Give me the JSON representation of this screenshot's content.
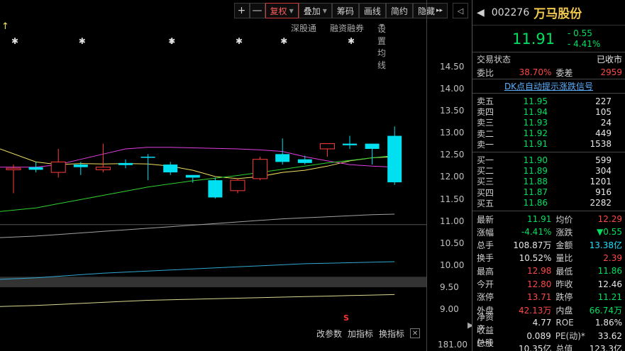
{
  "toolbar": {
    "zoom_in": "+",
    "zoom_out": "—",
    "fuquan": "复权",
    "diejia": "叠加",
    "chouma": "筹码",
    "huaxian": "画线",
    "jianyue": "简约",
    "yincang": "隐藏",
    "more": "▸▸",
    "collapse": "◁"
  },
  "subnav": {
    "shengutong": "深股通",
    "rongzi": "融资融券",
    "settings": "设置均线"
  },
  "price_axis": [
    "14.50",
    "14.00",
    "13.50",
    "13.00",
    "12.50",
    "12.00",
    "11.50",
    "11.00",
    "10.50",
    "10.00",
    "9.50",
    "9.00"
  ],
  "bottom_price": "181.00",
  "bottom_tabs": {
    "params": "改参数",
    "add": "加指标",
    "switch": "换指标",
    "close": "✕"
  },
  "marker_s": "S",
  "chart_data": {
    "type": "candlestick",
    "candles": [
      {
        "o": 12.15,
        "h": 12.25,
        "l": 11.7,
        "c": 12.18,
        "up": true
      },
      {
        "o": 12.2,
        "h": 12.3,
        "l": 12.1,
        "c": 12.15,
        "up": false
      },
      {
        "o": 12.1,
        "h": 12.55,
        "l": 12.0,
        "c": 12.3,
        "up": true
      },
      {
        "o": 12.25,
        "h": 12.3,
        "l": 12.05,
        "c": 12.2,
        "up": false
      },
      {
        "o": 12.15,
        "h": 12.65,
        "l": 12.1,
        "c": 12.2,
        "up": true
      },
      {
        "o": 12.28,
        "h": 12.35,
        "l": 12.18,
        "c": 12.24,
        "up": false
      },
      {
        "o": 12.4,
        "h": 12.45,
        "l": 11.95,
        "c": 12.38,
        "up": false
      },
      {
        "o": 12.25,
        "h": 12.3,
        "l": 12.05,
        "c": 12.1,
        "up": false
      },
      {
        "o": 12.05,
        "h": 12.05,
        "l": 11.9,
        "c": 12.0,
        "up": false
      },
      {
        "o": 11.95,
        "h": 12.0,
        "l": 11.6,
        "c": 11.62,
        "up": false
      },
      {
        "o": 11.75,
        "h": 11.98,
        "l": 11.7,
        "c": 11.95,
        "up": true
      },
      {
        "o": 11.98,
        "h": 12.4,
        "l": 11.95,
        "c": 12.35,
        "up": true
      },
      {
        "o": 12.45,
        "h": 12.75,
        "l": 12.25,
        "c": 12.3,
        "up": false
      },
      {
        "o": 12.35,
        "h": 12.42,
        "l": 12.25,
        "c": 12.28,
        "up": false
      },
      {
        "o": 12.55,
        "h": 12.65,
        "l": 12.4,
        "c": 12.65,
        "up": true
      },
      {
        "o": 12.65,
        "h": 12.8,
        "l": 12.55,
        "c": 12.62,
        "up": false
      },
      {
        "o": 12.65,
        "h": 12.65,
        "l": 12.25,
        "c": 12.55,
        "up": false
      },
      {
        "o": 12.8,
        "h": 12.98,
        "l": 11.86,
        "c": 11.91,
        "up": false
      }
    ],
    "ma_lines": [
      {
        "color": "#f0e060",
        "values": [
          12.55,
          12.3,
          12.25,
          12.27,
          12.26,
          12.27,
          12.26,
          12.22,
          12.14,
          12.02,
          11.98,
          12.02,
          12.1,
          12.14,
          12.22,
          12.32,
          12.38,
          12.4
        ]
      },
      {
        "color": "#e040e0",
        "values": [
          12.2,
          12.2,
          12.25,
          12.35,
          12.45,
          12.55,
          12.58,
          12.58,
          12.57,
          12.56,
          12.55,
          12.53,
          12.5,
          12.4,
          12.32,
          12.25,
          12.22,
          12.2
        ]
      },
      {
        "color": "#30d030",
        "values": [
          11.35,
          11.42,
          11.5,
          11.58,
          11.66,
          11.74,
          11.82,
          11.88,
          11.94,
          11.99,
          12.04,
          12.1,
          12.16,
          12.22,
          12.28,
          12.33,
          12.38,
          12.42
        ]
      },
      {
        "color": "#a0a0a0",
        "values": [
          10.85,
          10.88,
          10.91,
          10.94,
          10.97,
          11.0,
          11.03,
          11.06,
          11.09,
          11.12,
          11.15,
          11.18,
          11.21,
          11.23,
          11.25,
          11.27,
          11.29,
          11.3
        ]
      },
      {
        "color": "#30a8d0",
        "values": [
          10.05,
          10.08,
          10.11,
          10.14,
          10.17,
          10.19,
          10.21,
          10.23,
          10.25,
          10.27,
          10.29,
          10.31,
          10.33,
          10.35,
          10.36,
          10.37,
          10.38,
          10.39
        ]
      },
      {
        "color": "#d8d890",
        "values": [
          9.53,
          9.55,
          9.57,
          9.59,
          9.61,
          9.63,
          9.65,
          9.66,
          9.67,
          9.68,
          9.69,
          9.7,
          9.71,
          9.72,
          9.73,
          9.74,
          9.75,
          9.76
        ]
      }
    ],
    "ylim": [
      8.95,
      14.75
    ],
    "ref_price": 10.0,
    "star_markers": [
      0,
      3,
      7,
      10,
      12,
      15
    ],
    "arrow_marker_index": 7
  },
  "stock": {
    "back": "◀",
    "code": "002276",
    "name": "万马股份",
    "price": "11.91",
    "change": "- 0.55",
    "change_pct": "- 4.41%"
  },
  "status": {
    "label": "交易状态",
    "value": "已收市",
    "weibi_label": "委比",
    "weibi": "38.70%",
    "weicha_label": "委差",
    "weicha": "2959"
  },
  "signal_link": "DK点自动提示涨跌信号",
  "sells": [
    {
      "label": "卖五",
      "price": "11.95",
      "vol": "227"
    },
    {
      "label": "卖四",
      "price": "11.94",
      "vol": "105"
    },
    {
      "label": "卖三",
      "price": "11.93",
      "vol": "24"
    },
    {
      "label": "卖二",
      "price": "11.92",
      "vol": "449"
    },
    {
      "label": "卖一",
      "price": "11.91",
      "vol": "1538"
    }
  ],
  "buys": [
    {
      "label": "买一",
      "price": "11.90",
      "vol": "599"
    },
    {
      "label": "买二",
      "price": "11.89",
      "vol": "304"
    },
    {
      "label": "买三",
      "price": "11.88",
      "vol": "1201"
    },
    {
      "label": "买四",
      "price": "11.87",
      "vol": "916"
    },
    {
      "label": "买五",
      "price": "11.86",
      "vol": "2282"
    }
  ],
  "stats": [
    {
      "k1": "最新",
      "v1": "11.91",
      "c1": "green",
      "k2": "均价",
      "v2": "12.29",
      "c2": "red"
    },
    {
      "k1": "涨幅",
      "v1": "-4.41%",
      "c1": "green",
      "k2": "涨跌",
      "v2": "▼0.55",
      "c2": "green"
    },
    {
      "k1": "总手",
      "v1": "108.87万",
      "c1": "white",
      "k2": "金额",
      "v2": "13.38亿",
      "c2": "cyan"
    },
    {
      "k1": "换手",
      "v1": "10.52%",
      "c1": "white",
      "k2": "量比",
      "v2": "2.39",
      "c2": "red"
    },
    {
      "k1": "最高",
      "v1": "12.98",
      "c1": "red",
      "k2": "最低",
      "v2": "11.86",
      "c2": "green"
    },
    {
      "k1": "今开",
      "v1": "12.80",
      "c1": "red",
      "k2": "昨收",
      "v2": "12.46",
      "c2": "white"
    },
    {
      "k1": "涨停",
      "v1": "13.71",
      "c1": "red",
      "k2": "跌停",
      "v2": "11.21",
      "c2": "green"
    },
    {
      "k1": "外盘",
      "v1": "42.13万",
      "c1": "red",
      "k2": "内盘",
      "v2": "66.74万",
      "c2": "green"
    },
    {
      "k1": "净资产",
      "v1": "4.77",
      "c1": "white",
      "k2": "ROE",
      "v2": "1.86%",
      "c2": "white"
    },
    {
      "k1": "收益(一)",
      "v1": "0.089",
      "c1": "white",
      "k2": "PE(动)*",
      "v2": "33.62",
      "c2": "white"
    },
    {
      "k1": "总股本",
      "v1": "10.35亿",
      "c1": "white",
      "k2": "总值",
      "v2": "123.3亿",
      "c2": "white"
    }
  ]
}
